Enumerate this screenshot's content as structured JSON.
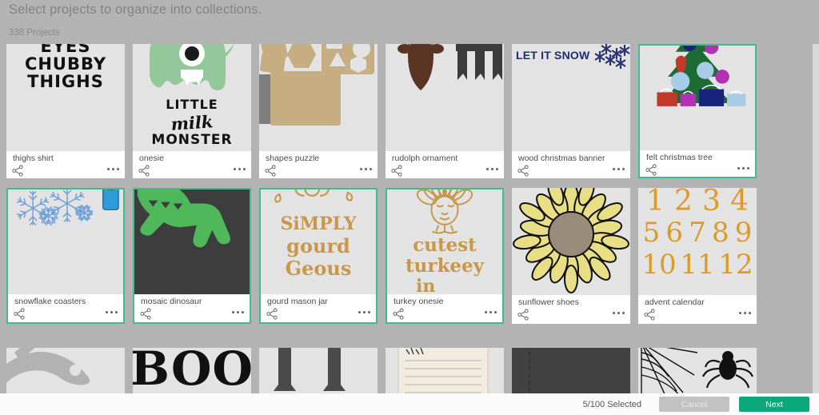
{
  "header": {
    "title": "Select projects to organize into collections.",
    "count_label": "338 Projects"
  },
  "bottom_bar": {
    "selection_label": "5/100 Selected",
    "cancel_label": "Cancel",
    "next_label": "Next"
  },
  "colors": {
    "page_background": "#b3b3b3",
    "card_background": "#ffffff",
    "thumbnail_background": "#e3e3e4",
    "selected_border": "#3fbb8c",
    "next_button": "#0aa87a",
    "cancel_button": "#c2c2c2",
    "title_text": "#838383",
    "card_title_text": "#4a4a4a"
  },
  "icons": {
    "share": "share-icon",
    "more": "more-options-icon"
  },
  "rows": [
    {
      "cards": [
        {
          "title": "thighs shirt",
          "selected": false,
          "art": "thighs-shirt"
        },
        {
          "title": "onesie",
          "selected": false,
          "art": "milk-monster"
        },
        {
          "title": "shapes puzzle",
          "selected": false,
          "art": "shapes-puzzle"
        },
        {
          "title": "rudolph ornament",
          "selected": false,
          "art": "rudolph"
        },
        {
          "title": "wood christmas banner",
          "selected": false,
          "art": "let-it-snow"
        },
        {
          "title": "felt christmas tree",
          "selected": true,
          "art": "christmas-tree"
        }
      ]
    },
    {
      "cards": [
        {
          "title": "snowflake coasters",
          "selected": true,
          "art": "snowflakes"
        },
        {
          "title": "mosaic dinosaur",
          "selected": true,
          "art": "dinosaur"
        },
        {
          "title": "gourd mason jar",
          "selected": true,
          "art": "gourd"
        },
        {
          "title": "turkey onesie",
          "selected": true,
          "art": "turkey"
        },
        {
          "title": "sunflower shoes",
          "selected": false,
          "art": "sunflower"
        },
        {
          "title": "advent calendar",
          "selected": false,
          "art": "advent"
        }
      ]
    },
    {
      "cards": [
        {
          "title": "",
          "selected": false,
          "art": "dolphin"
        },
        {
          "title": "",
          "selected": false,
          "art": "boo"
        },
        {
          "title": "",
          "selected": false,
          "art": "candlesticks"
        },
        {
          "title": "",
          "selected": false,
          "art": "notepad"
        },
        {
          "title": "",
          "selected": false,
          "art": "dark-block"
        },
        {
          "title": "",
          "selected": false,
          "art": "spider-web"
        }
      ]
    }
  ],
  "art_text": {
    "thighs_shirt": [
      "EYES",
      "CHUBBY",
      "THIGHS"
    ],
    "milk_monster": [
      "LITTLE",
      "milk",
      "MONSTER"
    ],
    "let_it_snow": "LET IT SNOW",
    "gourd": [
      "SiMPLY",
      "gourd",
      "Geous"
    ],
    "turkey": [
      "cutest",
      "turkeey",
      "in town"
    ],
    "advent": [
      "1",
      "2",
      "3",
      "4",
      "5",
      "6",
      "7",
      "8",
      "9",
      "10",
      "11",
      "12"
    ],
    "boo": "BOO"
  }
}
